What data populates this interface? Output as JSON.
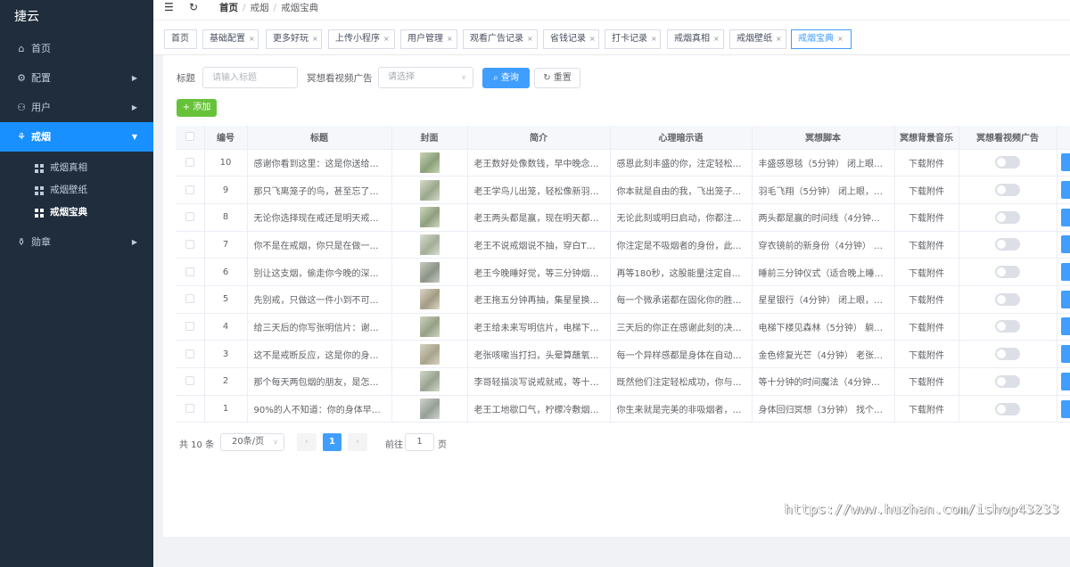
{
  "sidebar": {
    "brand": "捷云",
    "items": [
      {
        "label": "首页",
        "icon": "home-icon",
        "glyph": "⌂"
      },
      {
        "label": "配置",
        "icon": "gear-icon",
        "glyph": "⚙"
      },
      {
        "label": "用户",
        "icon": "user-icon",
        "glyph": "⚇"
      },
      {
        "label": "戒烟",
        "icon": "no-smoking-icon",
        "glyph": "⚘"
      },
      {
        "label": "勋章",
        "icon": "medal-icon",
        "glyph": "⚱"
      }
    ],
    "sub_items": [
      {
        "label": "戒烟真相"
      },
      {
        "label": "戒烟壁纸"
      },
      {
        "label": "戒烟宝典"
      }
    ]
  },
  "header": {
    "breadcrumb": [
      "首页",
      "戒烟",
      "戒烟宝典"
    ]
  },
  "tags": [
    {
      "label": "首页",
      "closable": false
    },
    {
      "label": "基础配置",
      "closable": true
    },
    {
      "label": "更多好玩",
      "closable": true
    },
    {
      "label": "上传小程序",
      "closable": true
    },
    {
      "label": "用户管理",
      "closable": true
    },
    {
      "label": "观看广告记录",
      "closable": true
    },
    {
      "label": "省钱记录",
      "closable": true
    },
    {
      "label": "打卡记录",
      "closable": true
    },
    {
      "label": "戒烟真相",
      "closable": true
    },
    {
      "label": "戒烟壁纸",
      "closable": true
    },
    {
      "label": "戒烟宝典",
      "closable": true
    }
  ],
  "filter": {
    "title_label": "标题",
    "title_placeholder": "请输入标题",
    "ad_label": "冥想看视频广告",
    "ad_placeholder": "请选择",
    "search_label": "查询",
    "reset_label": "重置",
    "add_label": "添加"
  },
  "table": {
    "columns": [
      "编号",
      "标题",
      "封面",
      "简介",
      "心理暗示语",
      "冥想脚本",
      "冥想背景音乐",
      "冥想看视频广告"
    ],
    "music_text": "下载附件",
    "rows": [
      {
        "id": "10",
        "title": "感谢你看到这里：这是你送给自...",
        "intro": "老王数好处像数钱，早中晚念必...",
        "hint": "感恩此刻丰盛的你，注定轻松的...",
        "script": "丰盛感恩毯（5分钟） 闭上眼，..."
      },
      {
        "id": "9",
        "title": "那只飞离笼子的鸟，甚至忘了门...",
        "intro": "老王学鸟儿出笼，轻松像新羽毛...",
        "hint": "你本就是自由的我，飞出笼子...",
        "script": "羽毛飞翔（5分钟） 闭上眼，想..."
      },
      {
        "id": "8",
        "title": "无论你选择现在戒还是明天戒，...",
        "intro": "老王两头都是赢，现在明天都能...",
        "hint": "无论此刻或明日启动，你都注定...",
        "script": "两头都是赢的时间线（4分钟） ..."
      },
      {
        "id": "7",
        "title": "你不是在戒烟，你只是在做一个...",
        "intro": "老王不说戒烟说不抽，穿白T恤不...",
        "hint": "你注定是不吸烟者的身份，此刻...",
        "script": "穿衣镜前的新身份（4分钟） 闭..."
      },
      {
        "id": "6",
        "title": "别让这支烟，偷走你今晚的深度...",
        "intro": "老王今晚睡好觉，等三分钟烟瘾...",
        "hint": "再等180秒，这股能量注定自行...",
        "script": "睡前三分钟仪式（适合晚上睡前..."
      },
      {
        "id": "5",
        "title": "先别戒，只做这一件小到不可能...",
        "intro": "老王拖五分钟再抽，集星星换酒...",
        "hint": "每一个微承诺都在固化你的胜利...",
        "script": "星星银行（4分钟） 闭上眼，想..."
      },
      {
        "id": "4",
        "title": "给三天后的你写张明信片：谢谢...",
        "intro": "老王给未来写明信片，电梯下楼...",
        "hint": "三天后的你正在感谢此刻的决定...",
        "script": "电梯下楼见森林（5分钟） 躺下..."
      },
      {
        "id": "3",
        "title": "这不是戒断反应，这是你的身体...",
        "intro": "老张咳嗽当打扫，头晕算蘸氧，...",
        "hint": "每一个异样感都是身体在自动修...",
        "script": "金色修复光芒（4分钟） 老张说..."
      },
      {
        "id": "2",
        "title": "那个每天两包烟的朋友，是怎么...",
        "intro": "李哥轻描淡写说戒就戒，等十分...",
        "hint": "既然他们注定轻松成功，你与他...",
        "script": "等十分钟的时间魔法（4分钟） ..."
      },
      {
        "id": "1",
        "title": "90%的人不知道：你的身体早就...",
        "intro": "老王工地歇口气，柠檬冷敷烟瘾...",
        "hint": "你生来就是完美的非吸烟者，此...",
        "script": "身体回归冥想（3分钟） 找个舒..."
      }
    ]
  },
  "pagination": {
    "total_text": "共 10 条",
    "page_size": "20条/页",
    "current_page": "1",
    "goto_prefix": "前往",
    "goto_value": "1",
    "goto_suffix": "页"
  },
  "watermark": "https://www.huzhan.com/ishop43233",
  "colors": {
    "sidebar_bg": "#1f2d3d",
    "accent": "#409eff",
    "active_menu": "#1890ff",
    "add_button": "#67c23a"
  }
}
